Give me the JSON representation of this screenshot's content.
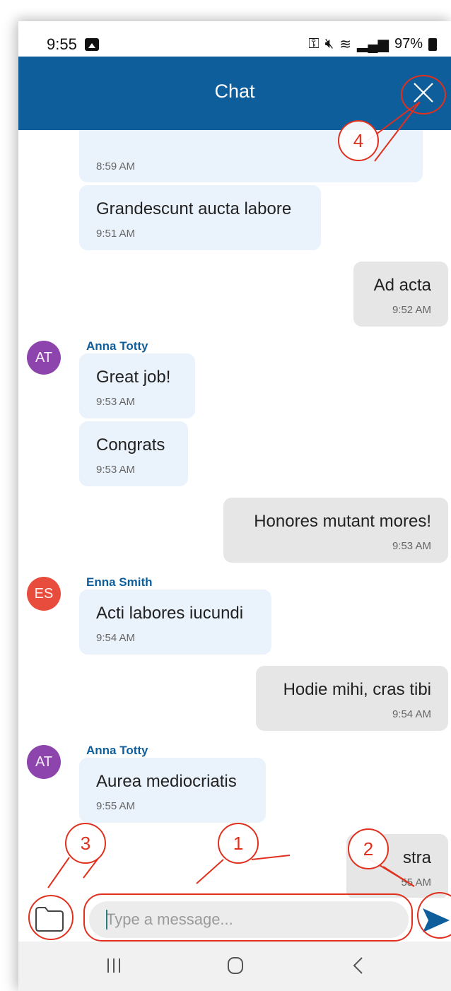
{
  "status_bar": {
    "time": "9:55",
    "battery": "97%"
  },
  "header": {
    "title": "Chat"
  },
  "messages": [
    {
      "direction": "in",
      "text": "",
      "time": "8:59 AM"
    },
    {
      "direction": "in",
      "text": "Grandescunt aucta labore",
      "time": "9:51 AM"
    },
    {
      "direction": "out",
      "text": "Ad acta",
      "time": "9:52 AM"
    },
    {
      "direction": "in",
      "sender": "Anna Totty",
      "avatar": "AT",
      "text": "Great job!",
      "time": "9:53 AM"
    },
    {
      "direction": "in",
      "text": "Congrats",
      "time": "9:53 AM"
    },
    {
      "direction": "out",
      "text": "Honores mutant mores!",
      "time": "9:53 AM"
    },
    {
      "direction": "in",
      "sender": "Enna Smith",
      "avatar": "ES",
      "text": "Acti labores iucundi",
      "time": "9:54 AM"
    },
    {
      "direction": "out",
      "text": "Hodie mihi, cras tibi",
      "time": "9:54 AM"
    },
    {
      "direction": "in",
      "sender": "Anna Totty",
      "avatar": "AT",
      "text": "Aurea mediocriatis",
      "time": "9:55 AM"
    },
    {
      "direction": "out",
      "text": "stra",
      "time": "55 AM"
    }
  ],
  "composer": {
    "placeholder": "Type a message..."
  },
  "annotations": [
    "1",
    "2",
    "3",
    "4"
  ],
  "colors": {
    "header": "#0f5e9c",
    "avatar_anna": "#8e44ad",
    "avatar_enna": "#e74c3c",
    "annotation": "#e0301e",
    "incoming_bubble": "#eaf2fc",
    "outgoing_bubble": "#e6e6e6"
  }
}
